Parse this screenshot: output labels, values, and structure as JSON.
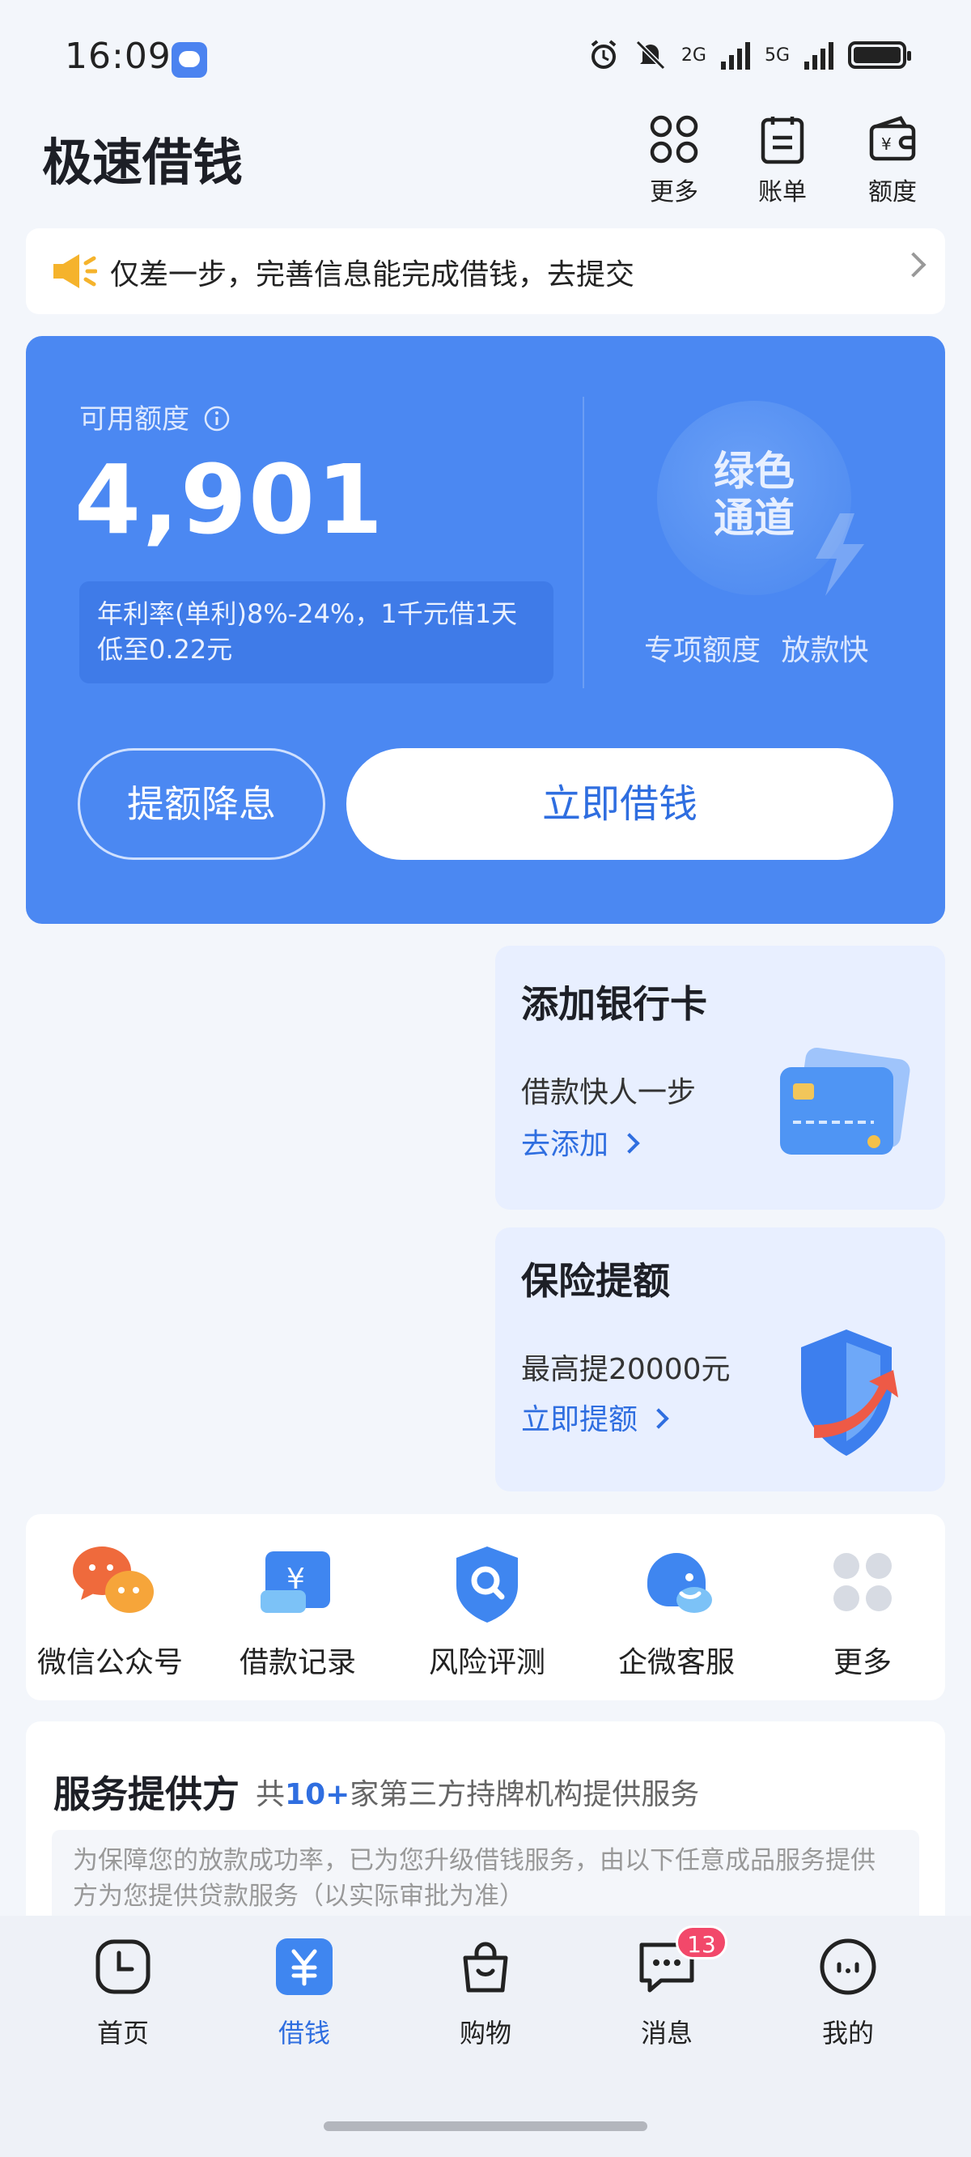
{
  "status_bar": {
    "time": "16:09",
    "net1": "2G",
    "net2": "5G"
  },
  "header": {
    "title": "极速借钱",
    "actions": [
      {
        "label": "更多",
        "icon": "grid-icon"
      },
      {
        "label": "账单",
        "icon": "bill-icon"
      },
      {
        "label": "额度",
        "icon": "wallet-icon"
      }
    ]
  },
  "notice": {
    "text": "仅差一步，完善信息能完成借钱，去提交",
    "icon": "speaker-icon"
  },
  "card": {
    "label": "可用额度",
    "amount": "4,901",
    "rate": "年利率(单利)8%-24%，1千元借1天低至0.22元",
    "badge": "绿色通道",
    "sub": "专项额度 放款快",
    "btn_secondary": "提额降息",
    "btn_primary": "立即借钱",
    "colors": {
      "card": "#4b88f2",
      "accent": "#2f6ee0"
    }
  },
  "promos": [
    {
      "title": "添加银行卡",
      "desc": "借款快人一步",
      "link": "去添加",
      "icon": "bank-card-icon"
    },
    {
      "title": "保险提额",
      "desc": "最高提20000元",
      "link": "立即提额",
      "icon": "shield-icon"
    }
  ],
  "quick": [
    {
      "label": "微信公众号",
      "icon": "wechat-icon"
    },
    {
      "label": "借款记录",
      "icon": "loan-record-icon"
    },
    {
      "label": "风险评测",
      "icon": "risk-search-icon"
    },
    {
      "label": "企微客服",
      "icon": "service-icon"
    },
    {
      "label": "更多",
      "icon": "more-dots-icon"
    }
  ],
  "service": {
    "title": "服务提供方",
    "sub_prefix": "共",
    "sub_count": "10+",
    "sub_suffix": "家第三方持牌机构提供服务",
    "desc": "为保障您的放款成功率，已为您升级借钱服务，由以下任意成品服务提供方为您提供贷款服务（以实际审批为准）"
  },
  "tabs": [
    {
      "label": "首页",
      "icon": "clock-home-icon",
      "active": false
    },
    {
      "label": "借钱",
      "icon": "yuan-icon",
      "active": true
    },
    {
      "label": "购物",
      "icon": "bag-icon",
      "active": false
    },
    {
      "label": "消息",
      "icon": "message-icon",
      "active": false,
      "badge": "13"
    },
    {
      "label": "我的",
      "icon": "profile-icon",
      "active": false
    }
  ]
}
